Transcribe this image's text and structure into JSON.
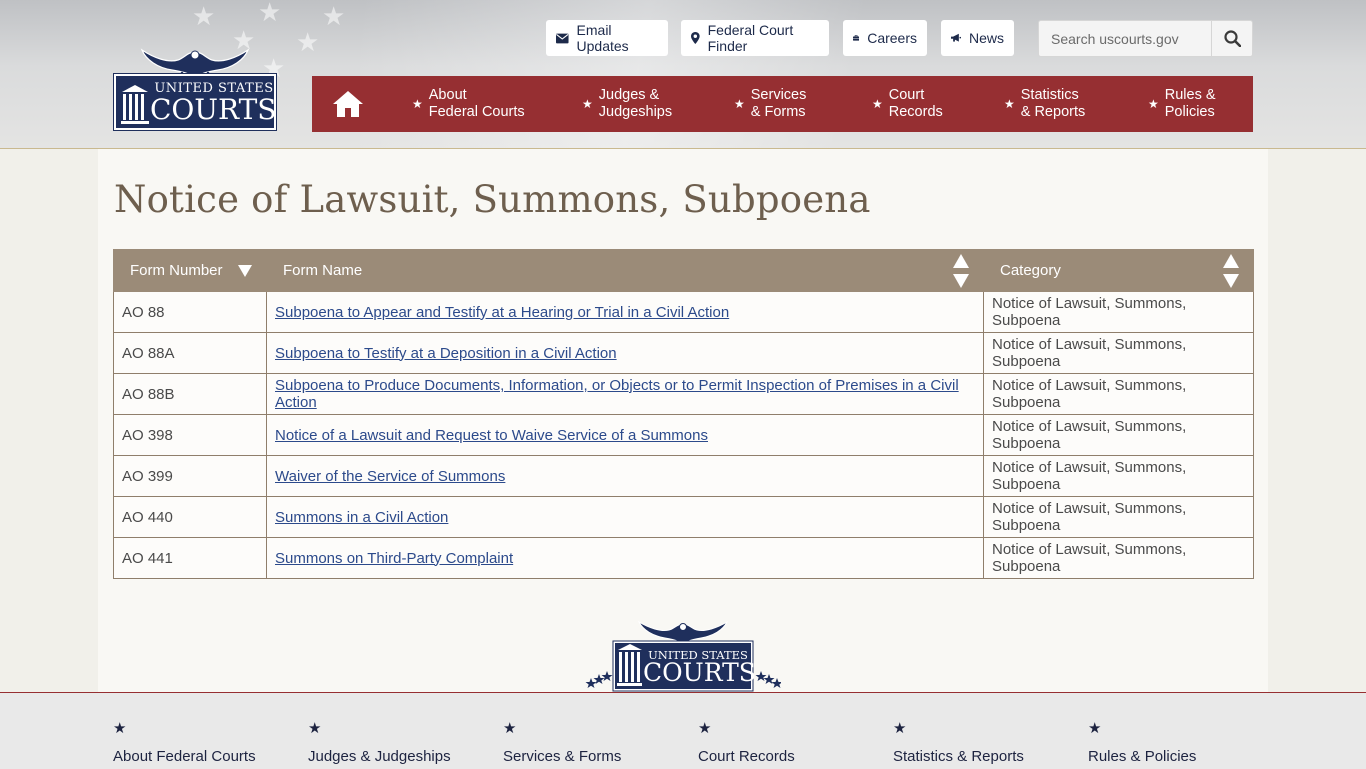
{
  "logo": {
    "line1": "UNITED STATES",
    "line2": "COURTS"
  },
  "utility_nav": [
    {
      "label": "Email Updates",
      "icon": "envelope-icon"
    },
    {
      "label": "Federal Court Finder",
      "icon": "map-pin-icon"
    },
    {
      "label": "Careers",
      "icon": "briefcase-icon"
    },
    {
      "label": "News",
      "icon": "megaphone-icon"
    }
  ],
  "search": {
    "placeholder": "Search uscourts.gov",
    "icon": "search-icon"
  },
  "main_nav": {
    "home_icon": "home-icon",
    "items": [
      {
        "label": "About\nFederal Courts"
      },
      {
        "label": "Judges &\nJudgeships"
      },
      {
        "label": "Services\n& Forms"
      },
      {
        "label": "Court\nRecords"
      },
      {
        "label": "Statistics\n& Reports"
      },
      {
        "label": "Rules &\nPolicies"
      }
    ]
  },
  "page": {
    "title": "Notice of Lawsuit, Summons, Subpoena"
  },
  "table": {
    "headers": [
      "Form Number",
      "Form Name",
      "Category"
    ],
    "rows": [
      {
        "number": "AO 88",
        "name": "Subpoena to Appear and Testify at a Hearing or Trial in a Civil Action",
        "category": "Notice of Lawsuit, Summons, Subpoena"
      },
      {
        "number": "AO 88A",
        "name": "Subpoena to Testify at a Deposition in a Civil Action",
        "category": "Notice of Lawsuit, Summons, Subpoena"
      },
      {
        "number": "AO 88B",
        "name": "Subpoena to Produce Documents, Information, or Objects or to Permit Inspection of Premises in a Civil Action",
        "category": "Notice of Lawsuit, Summons, Subpoena"
      },
      {
        "number": "AO 398",
        "name": "Notice of a Lawsuit and Request to Waive Service of a Summons",
        "category": "Notice of Lawsuit, Summons, Subpoena"
      },
      {
        "number": "AO 399",
        "name": "Waiver of the Service of Summons",
        "category": "Notice of Lawsuit, Summons, Subpoena"
      },
      {
        "number": "AO 440",
        "name": "Summons in a Civil Action",
        "category": "Notice of Lawsuit, Summons, Subpoena"
      },
      {
        "number": "AO 441",
        "name": "Summons on Third-Party Complaint",
        "category": "Notice of Lawsuit, Summons, Subpoena"
      }
    ]
  },
  "footer_nav": [
    {
      "label": "About Federal Courts"
    },
    {
      "label": "Judges & Judgeships"
    },
    {
      "label": "Services & Forms"
    },
    {
      "label": "Court Records"
    },
    {
      "label": "Statistics & Reports"
    },
    {
      "label": "Rules & Policies"
    }
  ],
  "colors": {
    "nav_red": "#962f32",
    "table_header": "#9b8b78",
    "title": "#6e5f4e",
    "link": "#2c4a8b",
    "navy": "#1f2f5c"
  }
}
